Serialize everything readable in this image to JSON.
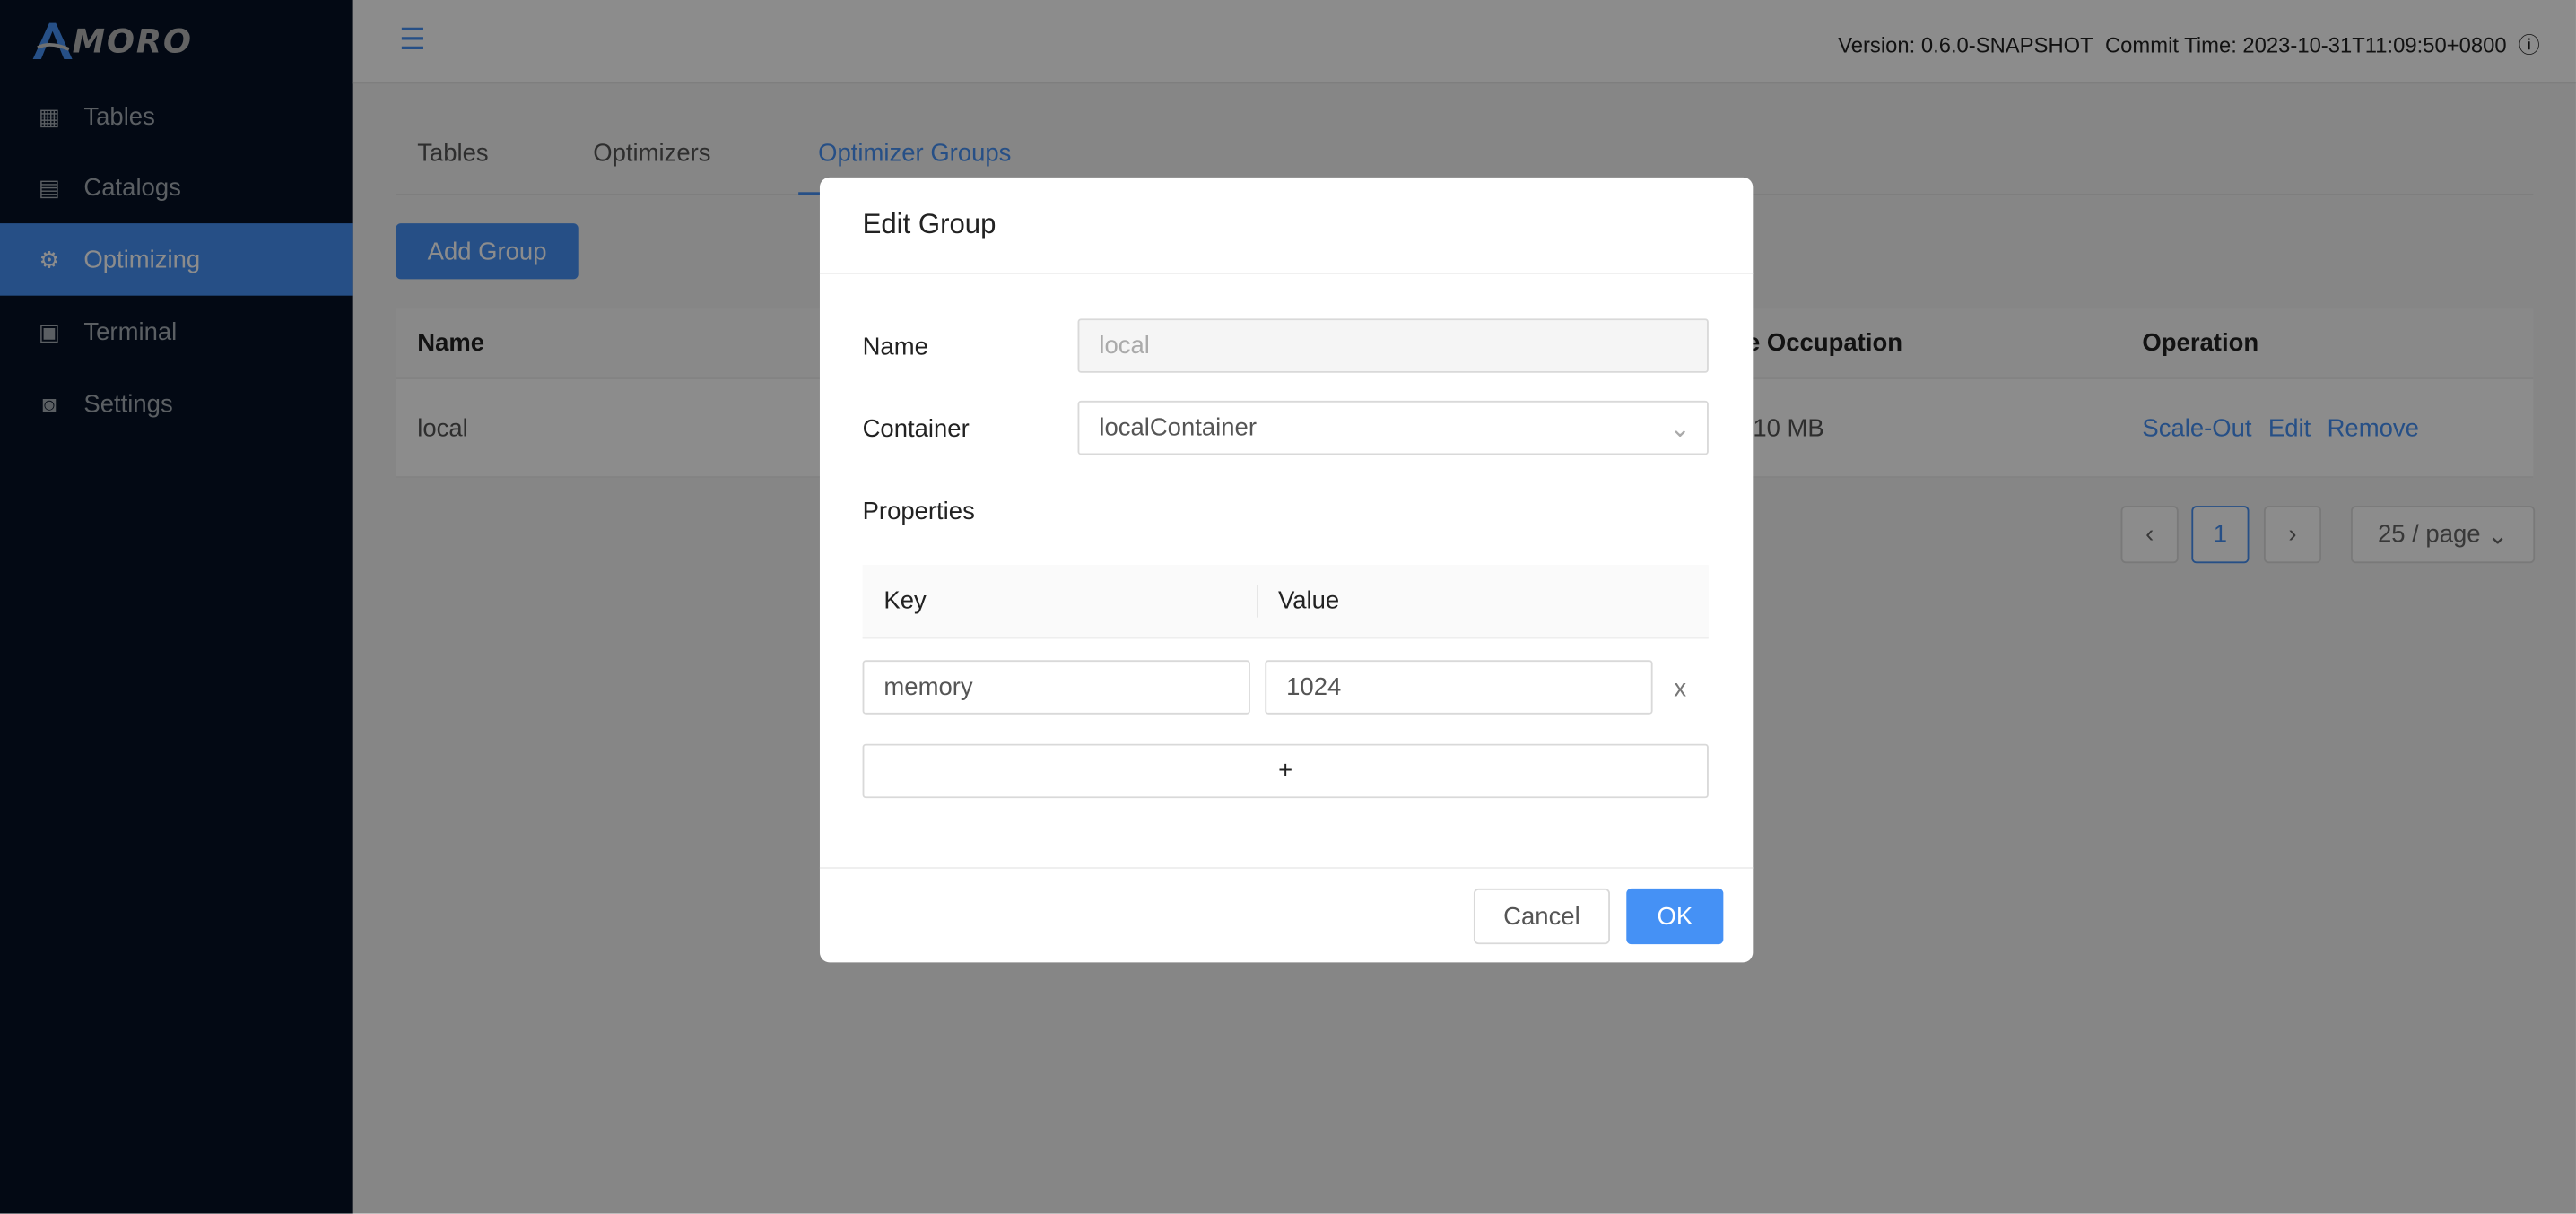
{
  "app": {
    "logo_text": "MORO",
    "version": "Version: 0.6.0-SNAPSHOT",
    "commit_time": "Commit Time: 2023-10-31T11:09:50+0800"
  },
  "sidebar": {
    "items": [
      {
        "label": "Tables",
        "icon": "table-icon"
      },
      {
        "label": "Catalogs",
        "icon": "catalog-icon"
      },
      {
        "label": "Optimizing",
        "icon": "optimizing-gear-icon",
        "active": true
      },
      {
        "label": "Terminal",
        "icon": "terminal-icon"
      },
      {
        "label": "Settings",
        "icon": "settings-icon"
      }
    ]
  },
  "tabs": [
    {
      "label": "Tables"
    },
    {
      "label": "Optimizers"
    },
    {
      "label": "Optimizer Groups",
      "active": true
    }
  ],
  "toolbar": {
    "add_group": "Add Group"
  },
  "table": {
    "headers": {
      "name": "Name",
      "occupation": "e Occupation",
      "operation": "Operation"
    },
    "rows": [
      {
        "name": "local",
        "occupation": "10 MB",
        "actions": [
          "Scale-Out",
          "Edit",
          "Remove"
        ]
      }
    ]
  },
  "pagination": {
    "current": "1",
    "page_size": "25 / page"
  },
  "modal": {
    "title": "Edit Group",
    "name_label": "Name",
    "name_value": "local",
    "container_label": "Container",
    "container_value": "localContainer",
    "properties_label": "Properties",
    "key_header": "Key",
    "value_header": "Value",
    "properties": [
      {
        "key": "memory",
        "value": "1024"
      }
    ],
    "add_label": "+",
    "remove_label": "x",
    "cancel": "Cancel",
    "ok": "OK"
  },
  "colors": {
    "accent": "#4591f5",
    "sidebar": "#061226"
  }
}
